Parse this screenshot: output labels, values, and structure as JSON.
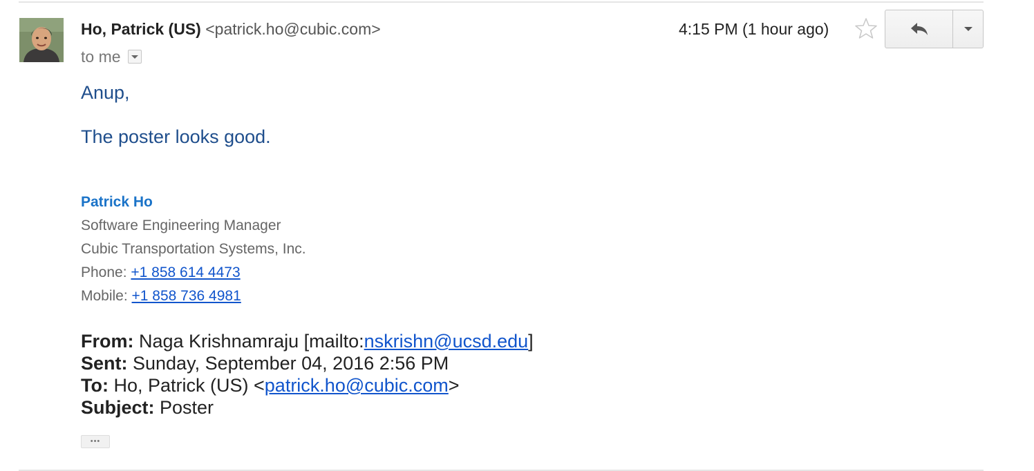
{
  "message": {
    "sender_name": "Ho, Patrick (US)",
    "sender_email": "<patrick.ho@cubic.com>",
    "recipient": "to me",
    "timestamp": "4:15 PM (1 hour ago)",
    "greeting": "Anup,",
    "body": "The poster looks good."
  },
  "signature": {
    "name": "Patrick Ho",
    "title": "Software Engineering Manager",
    "company": "Cubic Transportation Systems, Inc.",
    "phone_label": "Phone: ",
    "phone": "+1 858 614 4473",
    "mobile_label": "Mobile: ",
    "mobile": "+1 858 736 4981"
  },
  "quoted": {
    "from_label": "From:",
    "from_name": " Naga Krishnamraju [mailto:",
    "from_email": "nskrishn@ucsd.edu",
    "from_end": "]",
    "sent_label": "Sent:",
    "sent_value": " Sunday, September 04, 2016 2:56 PM",
    "to_label": "To:",
    "to_name": " Ho, Patrick (US) <",
    "to_email": "patrick.ho@cubic.com",
    "to_end": ">",
    "subject_label": "Subject:",
    "subject_value": " Poster"
  },
  "trimmed_content": "•••",
  "icons": {
    "star": "star-icon",
    "reply": "reply-icon",
    "more": "chevron-down-icon",
    "details": "chevron-down-icon"
  },
  "colors": {
    "body_text": "#1f4e8c",
    "signature_name": "#1a73c8",
    "link": "#1155cc"
  }
}
